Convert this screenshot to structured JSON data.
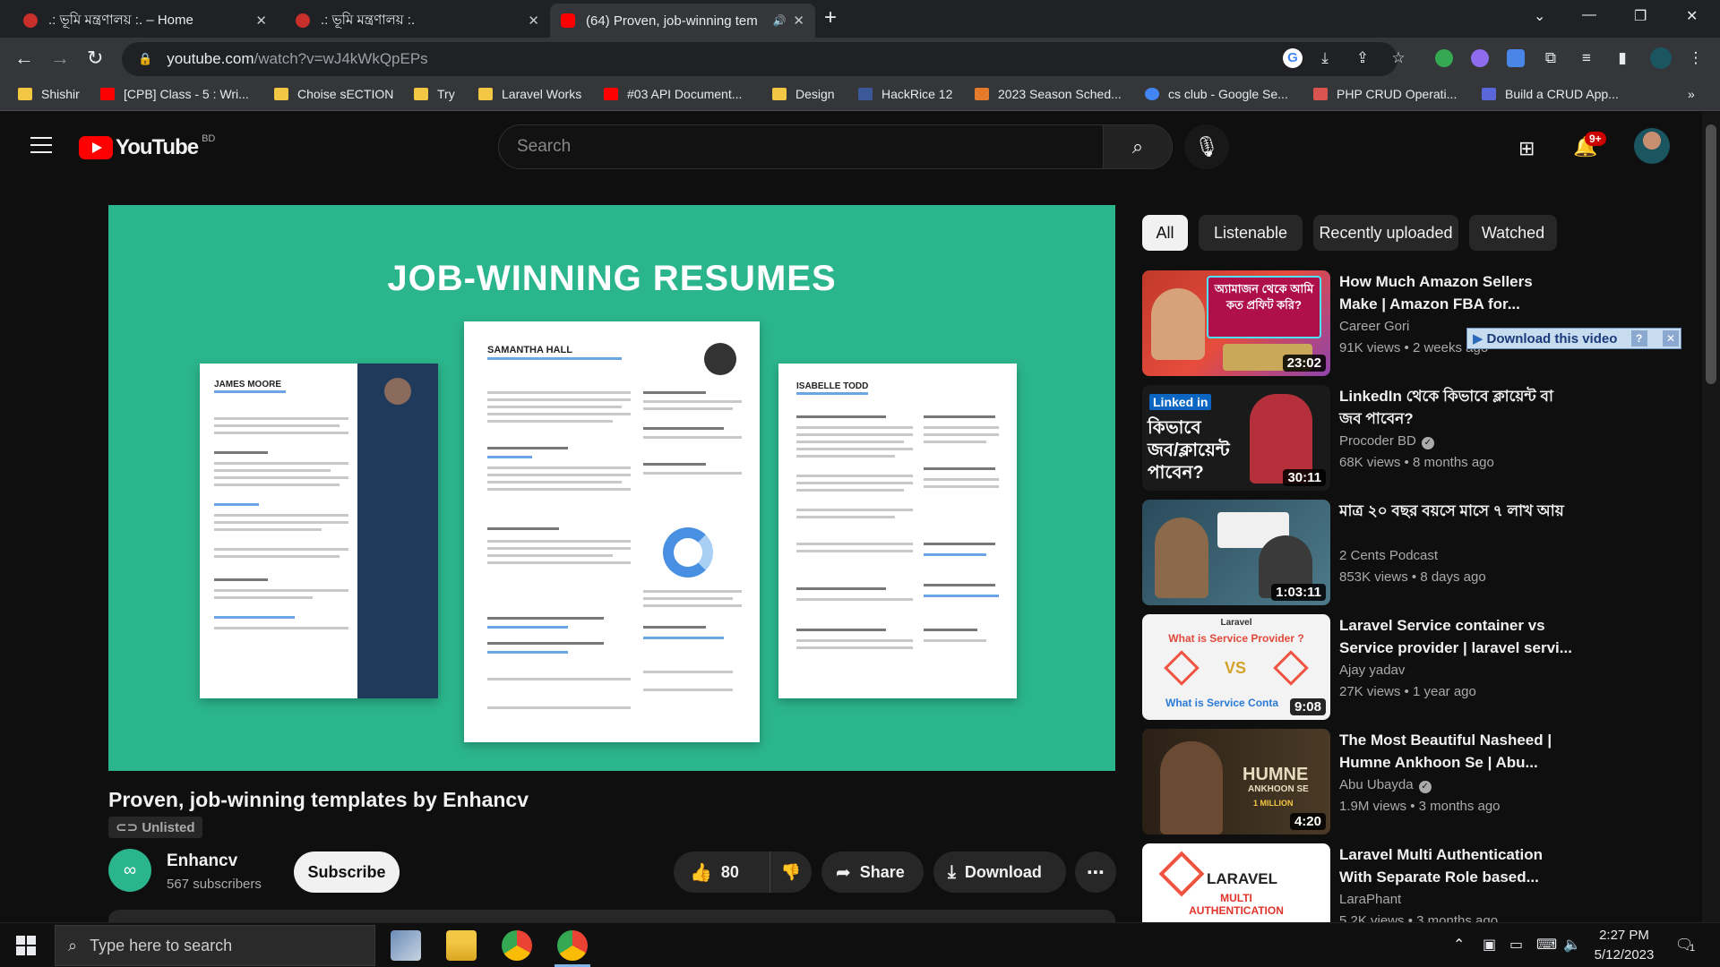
{
  "browser": {
    "tabs": [
      {
        "label": ".: ভূমি মন্ত্রণালয় :. – Home",
        "close": "✕",
        "fav_color": "#c9302c"
      },
      {
        "label": ".: ভূমি মন্ত্রণালয় :.",
        "close": "✕",
        "fav_color": "#c9302c"
      },
      {
        "label": "(64) Proven, job-winning tem",
        "close": "✕",
        "fav_color": "#ff0000",
        "audio": "🔊"
      }
    ],
    "new_tab": "+",
    "window_controls": {
      "dropdown": "⌄",
      "minimize": "—",
      "restore": "❐",
      "close": "✕"
    },
    "url_host": "youtube.com",
    "url_path": "/watch?v=wJ4kWkQpEPs",
    "bookmarks": [
      {
        "label": "Shishir",
        "color": "#f2c744"
      },
      {
        "label": "[CPB] Class - 5 : Wri...",
        "color": "#ff0000"
      },
      {
        "label": "Choise sECTION",
        "color": "#f2c744"
      },
      {
        "label": "Try",
        "color": "#f2c744"
      },
      {
        "label": "Laravel Works",
        "color": "#f2c744"
      },
      {
        "label": "#03 API Document...",
        "color": "#ff0000"
      },
      {
        "label": "Design",
        "color": "#f2c744"
      },
      {
        "label": "HackRice 12",
        "color": "#3b5998"
      },
      {
        "label": "2023 Season Sched...",
        "color": "#e37b2b"
      },
      {
        "label": "cs club - Google Se...",
        "color": "#4285f4"
      },
      {
        "label": "PHP CRUD Operati...",
        "color": "#d9534f"
      },
      {
        "label": "Build a CRUD App...",
        "color": "#5a67d8"
      }
    ],
    "bookmarks_more": "»"
  },
  "youtube": {
    "logo_text": "YouTube",
    "country_code": "BD",
    "search_placeholder": "Search",
    "notifications_badge": "9+",
    "thumbnail_title": "JOB-WINNING RESUMES",
    "resume_names": [
      "JAMES MOORE",
      "SAMANTHA HALL",
      "ISABELLE TODD"
    ],
    "video_title": "Proven, job-winning templates by Enhancv",
    "visibility": "Unlisted",
    "channel_name": "Enhancv",
    "channel_subs": "567 subscribers",
    "subscribe_label": "Subscribe",
    "likes": "80",
    "share_label": "Share",
    "download_label": "Download",
    "more_label": "⋯",
    "chips": [
      "All",
      "Listenable",
      "Recently uploaded",
      "Watched"
    ],
    "download_this_video": "Download this video",
    "recommendations": [
      {
        "title": "How Much Amazon Sellers Make | Amazon FBA for...",
        "channel": "Career Gori",
        "views": "91K views",
        "age": "2 weeks ago",
        "duration": "23:02",
        "verified": false,
        "thumb_text": "অ্যামাজন থেকে আমি কত প্রফিট করি?"
      },
      {
        "title": "LinkedIn থেকে কিভাবে ক্লায়েন্ট বা জব পাবেন?",
        "channel": "Procoder BD",
        "views": "68K views",
        "age": "8 months ago",
        "duration": "30:11",
        "verified": true,
        "thumb_badge": "Linked in",
        "thumb_text": "কিভাবে জব/ক্লায়েন্ট পাবেন?"
      },
      {
        "title": "মাত্র ২০ বছর বয়সে মাসে ৭ লাখ আয়",
        "channel": "2 Cents Podcast",
        "views": "853K views",
        "age": "8 days ago",
        "duration": "1:03:11",
        "verified": false
      },
      {
        "title": "Laravel Service container vs Service provider | laravel servi...",
        "channel": "Ajay yadav",
        "views": "27K views",
        "age": "1 year ago",
        "duration": "9:08",
        "verified": false,
        "thumb_top": "Laravel",
        "thumb_q1": "What is Service Provider ?",
        "thumb_vs": "VS",
        "thumb_q2": "What is Service Conta"
      },
      {
        "title": "The Most Beautiful Nasheed | Humne Ankhoon Se | Abu...",
        "channel": "Abu Ubayda",
        "views": "1.9M views",
        "age": "3 months ago",
        "duration": "4:20",
        "verified": true,
        "thumb_text": "HUMNE",
        "thumb_sub": "ANKHOON SE",
        "thumb_million": "1 MILLION"
      },
      {
        "title": "Laravel Multi Authentication With Separate Role based...",
        "channel": "LaraPhant",
        "views": "5.2K views",
        "age": "3 months ago",
        "duration": "",
        "verified": false,
        "thumb_text": "LARAVEL",
        "thumb_sub": "MULTI AUTHENTICATION"
      }
    ]
  },
  "taskbar": {
    "search_placeholder": "Type here to search",
    "time": "2:27 PM",
    "date": "5/12/2023",
    "notification_count": "1"
  }
}
